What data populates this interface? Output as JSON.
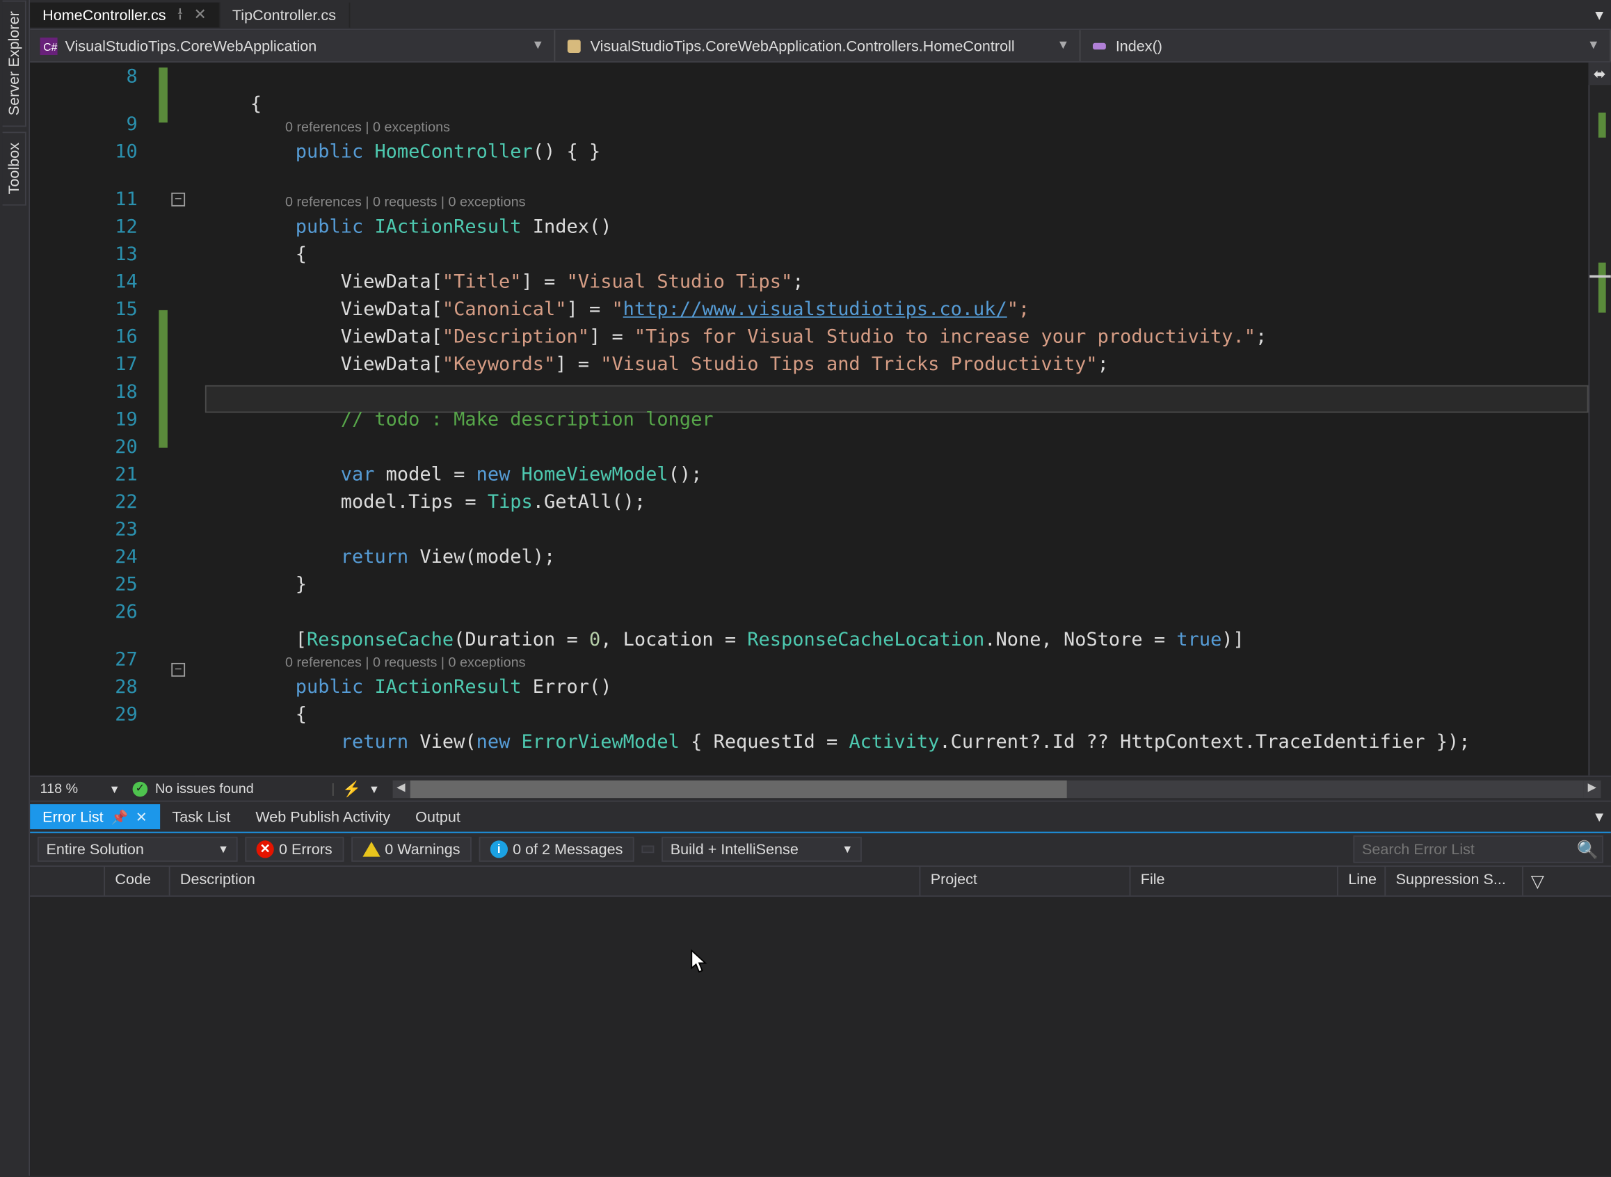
{
  "left_rail": {
    "tab1": "Server Explorer",
    "tab2": "Toolbox"
  },
  "file_tabs": [
    {
      "label": "HomeController.cs",
      "active": true,
      "pinned": true,
      "close": true
    },
    {
      "label": "TipController.cs",
      "active": false
    }
  ],
  "nav_bar": {
    "project": "VisualStudioTips.CoreWebApplication",
    "class": "VisualStudioTips.CoreWebApplication.Controllers.HomeControll",
    "member": "Index()"
  },
  "line_numbers": [
    "8",
    "9",
    "10",
    "11",
    "12",
    "13",
    "14",
    "15",
    "16",
    "17",
    "18",
    "19",
    "20",
    "21",
    "22",
    "23",
    "24",
    "25",
    "26",
    "27",
    "28",
    "29"
  ],
  "codelens": {
    "ctor": "0 references | 0 exceptions",
    "index": "0 references | 0 requests | 0 exceptions",
    "error": "0 references | 0 requests | 0 exceptions"
  },
  "code": {
    "l8": "{",
    "l9_kw": "public",
    "l9_type": "HomeController",
    "l9_rest": "() { }",
    "l11_kw": "public",
    "l11_type": "IActionResult",
    "l11_name": "Index",
    "l11_paren": "()",
    "l12": "{",
    "l13_a": "ViewData[",
    "l13_s": "\"Title\"",
    "l13_b": "] = ",
    "l13_v": "\"Visual Studio Tips\"",
    "l13_c": ";",
    "l14_a": "ViewData[",
    "l14_s": "\"Canonical\"",
    "l14_b": "] = ",
    "l14_q": "\"",
    "l14_url": "http://www.visualstudiotips.co.uk/",
    "l14_c": "\";",
    "l15_a": "ViewData[",
    "l15_s": "\"Description\"",
    "l15_b": "] = ",
    "l15_v": "\"Tips for Visual Studio to increase your productivity.\"",
    "l15_c": ";",
    "l16_a": "ViewData[",
    "l16_s": "\"Keywords\"",
    "l16_b": "] = ",
    "l16_v": "\"Visual Studio Tips and Tricks Productivity\"",
    "l16_c": ";",
    "l18": "// todo : Make description longer",
    "l20_var": "var",
    "l20_rest": " model = ",
    "l20_new": "new",
    "l20_sp": " ",
    "l20_type": "HomeViewModel",
    "l20_end": "();",
    "l21_a": "model.Tips = ",
    "l21_type": "Tips",
    "l21_b": ".GetAll();",
    "l23_ret": "return",
    "l23_sp": " ",
    "l23_view": "View",
    "l23_p": "(model);",
    "l24": "}",
    "l26_a": "[",
    "l26_type": "ResponseCache",
    "l26_b": "(Duration = ",
    "l26_n1": "0",
    "l26_c": ", Location = ",
    "l26_type2": "ResponseCacheLocation",
    "l26_d": ".None, NoStore = ",
    "l26_true": "true",
    "l26_e": ")]",
    "l27_kw": "public",
    "l27_sp": " ",
    "l27_type": "IActionResult",
    "l27_sp2": " ",
    "l27_name": "Error",
    "l27_p": "()",
    "l28": "{",
    "l29_ret": "return",
    "l29_a": " View(",
    "l29_new": "new",
    "l29_sp": " ",
    "l29_type": "ErrorViewModel",
    "l29_b": " { RequestId = ",
    "l29_type2": "Activity",
    "l29_c": ".Current?.Id ?? HttpContext.TraceIdentifier });"
  },
  "editor_status": {
    "zoom": "118 %",
    "issues": "No issues found"
  },
  "tool_window": {
    "tabs": {
      "error_list": "Error List",
      "task_list": "Task List",
      "web_publish": "Web Publish Activity",
      "output": "Output"
    },
    "toolbar": {
      "scope": "Entire Solution",
      "errors": "0 Errors",
      "warnings": "0 Warnings",
      "messages": "0 of 2 Messages",
      "build_intellisense": "Build + IntelliSense",
      "search_placeholder": "Search Error List"
    },
    "columns": {
      "code": "Code",
      "description": "Description",
      "project": "Project",
      "file": "File",
      "line": "Line",
      "suppression": "Suppression S..."
    }
  }
}
